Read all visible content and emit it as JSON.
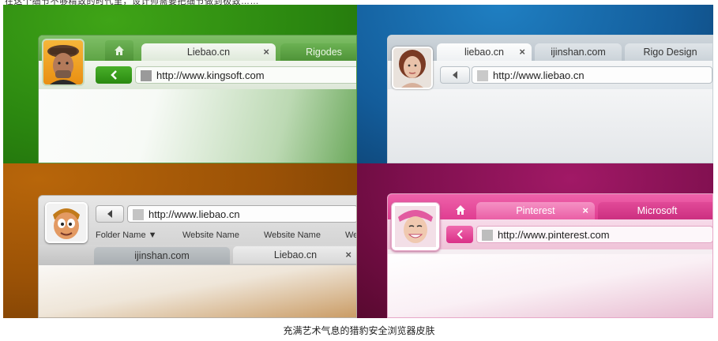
{
  "header_text": "在这个细节不够精致的时代里，设计师需要把细节做到极致……",
  "caption": "充满艺术气息的猎豹安全浏览器皮肤",
  "colors": {
    "green": "#2b8710",
    "blue": "#135c9a",
    "orange": "#9b5206",
    "pink": "#7d0f4d"
  },
  "green_skin": {
    "tabs": [
      {
        "label": "Liebao.cn",
        "close": "×"
      },
      {
        "label": "Rigodes",
        "close": ""
      }
    ],
    "home_icon": "home-icon",
    "back_icon": "chevron-left-icon",
    "url": "http://www.kingsoft.com"
  },
  "blue_skin": {
    "tabs": [
      {
        "label": "liebao.cn",
        "close": "×"
      },
      {
        "label": "ijinshan.com",
        "close": ""
      },
      {
        "label": "Rigo Design",
        "close": ""
      }
    ],
    "back_icon": "triangle-left-icon",
    "url": "http://www.liebao.cn"
  },
  "orange_skin": {
    "url": "http://www.liebao.cn",
    "bookmarks": [
      "Folder Name ▼",
      "Website Name",
      "Website Name",
      "We"
    ],
    "tabs": [
      {
        "label": "ijinshan.com",
        "close": ""
      },
      {
        "label": "Liebao.cn",
        "close": "×"
      }
    ]
  },
  "pink_skin": {
    "tabs": [
      {
        "label": "Pinterest",
        "close": "×"
      },
      {
        "label": "Microsoft",
        "close": ""
      }
    ],
    "home_icon": "home-icon",
    "url": "http://www.pinterest.com"
  }
}
